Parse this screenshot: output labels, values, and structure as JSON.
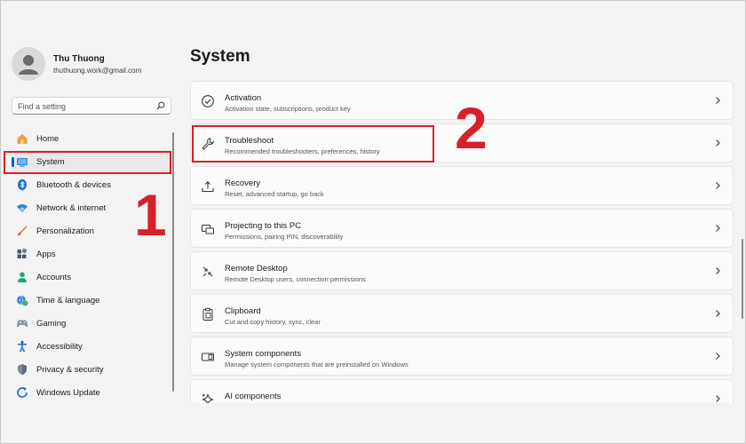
{
  "user": {
    "name": "Thu Thuong",
    "email": "thuthuong.work@gmail.com"
  },
  "search": {
    "placeholder": "Find a setting"
  },
  "sidebar": {
    "items": [
      {
        "label": "Home",
        "icon": "home-icon"
      },
      {
        "label": "System",
        "icon": "monitor-icon",
        "selected": true
      },
      {
        "label": "Bluetooth & devices",
        "icon": "bluetooth-icon"
      },
      {
        "label": "Network & internet",
        "icon": "wifi-icon"
      },
      {
        "label": "Personalization",
        "icon": "brush-icon"
      },
      {
        "label": "Apps",
        "icon": "apps-icon"
      },
      {
        "label": "Accounts",
        "icon": "person-icon"
      },
      {
        "label": "Time & language",
        "icon": "globe-clock-icon"
      },
      {
        "label": "Gaming",
        "icon": "gamepad-icon"
      },
      {
        "label": "Accessibility",
        "icon": "accessibility-icon"
      },
      {
        "label": "Privacy & security",
        "icon": "shield-icon"
      },
      {
        "label": "Windows Update",
        "icon": "update-icon"
      }
    ]
  },
  "main": {
    "title": "System",
    "items": [
      {
        "title": "Activation",
        "subtitle": "Activation state, subscriptions, product key",
        "icon": "check-circle-icon"
      },
      {
        "title": "Troubleshoot",
        "subtitle": "Recommended troubleshooters, preferences, history",
        "icon": "wrench-icon"
      },
      {
        "title": "Recovery",
        "subtitle": "Reset, advanced startup, go back",
        "icon": "recovery-icon"
      },
      {
        "title": "Projecting to this PC",
        "subtitle": "Permissions, pairing PIN, discoverability",
        "icon": "projecting-icon"
      },
      {
        "title": "Remote Desktop",
        "subtitle": "Remote Desktop users, connection permissions",
        "icon": "remote-desktop-icon"
      },
      {
        "title": "Clipboard",
        "subtitle": "Cut and copy history, sync, clear",
        "icon": "clipboard-icon"
      },
      {
        "title": "System components",
        "subtitle": "Manage system components that are preinstalled on Windows",
        "icon": "components-icon"
      },
      {
        "title": "AI components",
        "subtitle": "",
        "icon": "sparkle-icon"
      }
    ]
  },
  "annotations": {
    "step1": "1",
    "step2": "2",
    "color": "#d8202a"
  },
  "colors": {
    "accent": "#005fb8",
    "background": "#f3f3f3",
    "card": "#fbfbfb"
  }
}
